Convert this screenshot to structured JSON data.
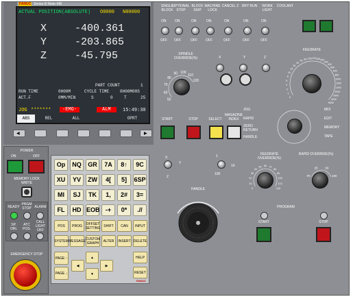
{
  "header": {
    "brand": "FANUC",
    "series": "Series 0i Mate-MB"
  },
  "screen": {
    "title": "ACTUAL POSITION(ABSOLUTE)",
    "prog_o": "O0000",
    "prog_n": "N00000",
    "axes": [
      {
        "name": "X",
        "value": "-400.361"
      },
      {
        "name": "Y",
        "value": "-203.865"
      },
      {
        "name": "Z",
        "value": "-45.795"
      }
    ],
    "part_count_label": "PART COUNT",
    "part_count": "1",
    "run_time_label": "RUN TIME",
    "run_time": "0H00M",
    "cycle_time_label": "CYCLE TIME",
    "cycle_time": "0H00M00S",
    "actf_label": "ACT.F",
    "actf": "0MM/MIN",
    "s_label": "S",
    "s_val": "0",
    "t_label": "T",
    "t_val": "25",
    "mode": "JOG",
    "stars": "*******",
    "emg": "-EMG-",
    "alm": "ALM",
    "clock": "15:49:30",
    "softkeys": [
      "ABS",
      "REL",
      "ALL",
      "",
      "OPRT"
    ]
  },
  "top_switches": [
    "SINGLE BLOCK",
    "OPTIONAL STOP",
    "BLOCK SKIP",
    "MACHINE LOCK",
    "CANCEL Z",
    "DRY RUN",
    "WORK LIGHT",
    "COOLANT"
  ],
  "on": "ON",
  "off": "OFF",
  "spindle_override": {
    "label": "SPINDLE OVERRIDE(%)",
    "ticks": [
      "50",
      "60",
      "70",
      "80",
      "90",
      "100",
      "110",
      "120"
    ]
  },
  "feedrate": {
    "label": "FEEDRATE",
    "ticks": [
      "0",
      "1",
      "2",
      "4",
      "6",
      "8",
      "10",
      "15",
      "20",
      "30",
      "50",
      "80",
      "100",
      "120",
      "150",
      "200",
      "300",
      "400",
      "500",
      "600",
      "800",
      "1000",
      "1200",
      "1400",
      "2000",
      "3000",
      "4000",
      "5000"
    ]
  },
  "spindle_buttons": [
    "START",
    "STOP",
    "SELECT",
    "MAGAZINE INDEX"
  ],
  "mode_labels": [
    "JOG",
    "RAPID",
    "ZERO RETURN",
    "HANDLE",
    "MDI",
    "EDIT",
    "MEMORY",
    "TAPE"
  ],
  "axis_x": "X",
  "axis_y": "Y",
  "axis_z": "Z",
  "step": [
    "1",
    "100",
    "10"
  ],
  "feed_override": {
    "label": "FEEDRATE OVERRIDE(%)",
    "ticks": [
      "0",
      "10",
      "20",
      "30",
      "40",
      "50",
      "60",
      "70",
      "80",
      "90",
      "100",
      "110",
      "120"
    ]
  },
  "rapid_override": {
    "label": "RAPID OVERRIDE(%)",
    "ticks": [
      "F0",
      "25",
      "50",
      "100"
    ]
  },
  "handle_label": "HANDLE",
  "program_label": "PROGRAM",
  "prog_start": "START",
  "prog_stop": "STOP",
  "power": {
    "label": "POWER",
    "on": "ON",
    "off": "OFF"
  },
  "memory_lock": "MEMORY LOCK WRITE",
  "lamps": [
    "READY",
    "PRGM STOP",
    "ALARM",
    "SP. ORI.",
    "ATC POS.",
    "CALL LIGHT OFF"
  ],
  "estop": "EMERGENCY STOP",
  "keypad": [
    [
      "Op",
      "NQ",
      "GR",
      "7A",
      "8↑",
      "9C"
    ],
    [
      "XU",
      "YV",
      "ZW",
      "4[",
      "5]",
      "6SP"
    ],
    [
      "MI",
      "SJ",
      "TK",
      "1,",
      "2#",
      "3="
    ],
    [
      "FL",
      "HD",
      "EOB",
      "-+",
      "0*",
      ".//"
    ]
  ],
  "fkeys": [
    [
      "POS",
      "PROG",
      "OFFSET SETTING",
      "SHIFT",
      "CAN",
      "INPUT"
    ],
    [
      "SYSTEM",
      "MESSAGE",
      "CUSTOM GRAPH",
      "ALTER",
      "INSERT",
      "DELETE"
    ]
  ],
  "page_up": "PAGE ↑",
  "page_down": "PAGE ↓",
  "help": "HELP",
  "reset": "RESET",
  "maker": "FANUC"
}
